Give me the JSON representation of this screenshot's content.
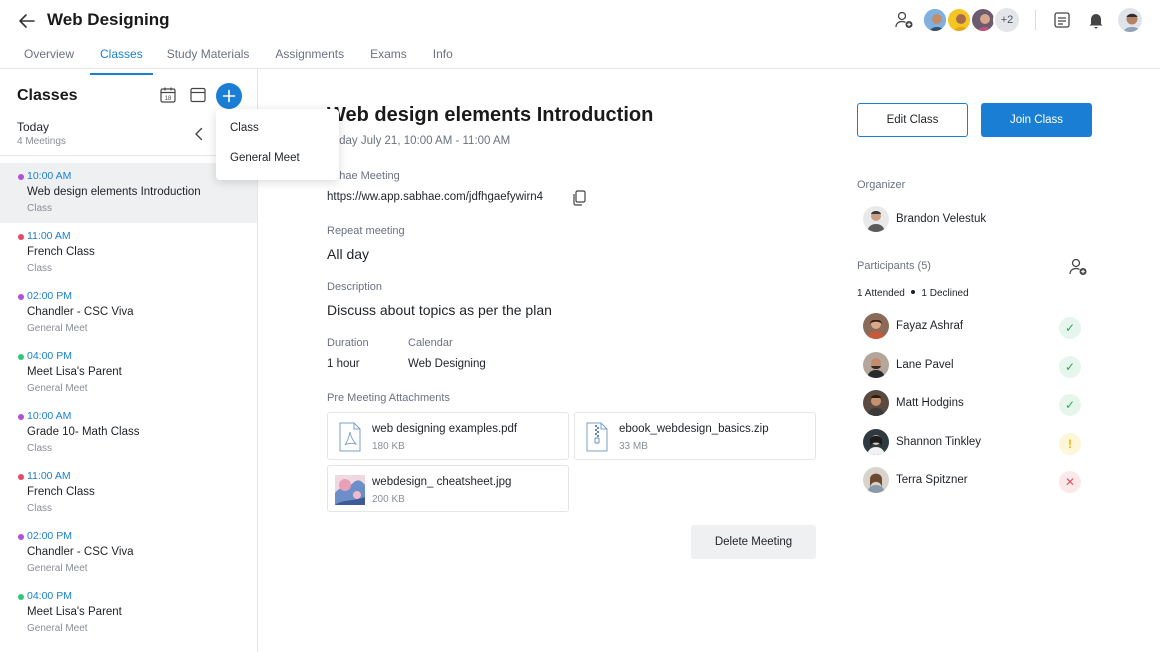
{
  "header": {
    "title": "Web Designing",
    "avatars_more": "+2",
    "tabs": [
      {
        "label": "Overview"
      },
      {
        "label": "Classes"
      },
      {
        "label": "Study Materials"
      },
      {
        "label": "Assignments"
      },
      {
        "label": "Exams"
      },
      {
        "label": "Info"
      }
    ],
    "active_tab": "Classes",
    "icons": [
      "back-arrow-icon",
      "add-user-icon",
      "layout-icon",
      "bell-icon"
    ]
  },
  "sidebar": {
    "title": "Classes",
    "date_icon_text": "18",
    "today": "Today",
    "meeting_count": "4 Meetings",
    "items": [
      {
        "time": "10:00 AM",
        "name": "Web design elements Introduction",
        "type": "Class",
        "dot": "#b14fd6"
      },
      {
        "time": "11:00 AM",
        "name": "French Class",
        "type": "Class",
        "dot": "#e8476a"
      },
      {
        "time": "02:00 PM",
        "name": "Chandler - CSC Viva",
        "type": "General Meet",
        "dot": "#b14fd6"
      },
      {
        "time": "04:00 PM",
        "name": "Meet Lisa's Parent",
        "type": "General Meet",
        "dot": "#34c77b"
      },
      {
        "time": "10:00 AM",
        "name": "Grade 10- Math Class",
        "type": "Class",
        "dot": "#b14fd6"
      },
      {
        "time": "11:00 AM",
        "name": "French Class",
        "type": "Class",
        "dot": "#e8476a"
      },
      {
        "time": "02:00 PM",
        "name": "Chandler - CSC Viva",
        "type": "General Meet",
        "dot": "#b14fd6"
      },
      {
        "time": "04:00 PM",
        "name": "Meet Lisa's Parent",
        "type": "General Meet",
        "dot": "#34c77b"
      }
    ]
  },
  "dropdown": {
    "items": [
      "Class",
      "General Meet"
    ]
  },
  "main": {
    "title": "Web design elements Introduction",
    "date": "esday July 21, 10:00 AM - 11:00 AM",
    "meeting_label": "abhae Meeting",
    "meeting_link": "https://ww.app.sabhae.com/jdfhgaefywirn4",
    "repeat_label": "Repeat meeting",
    "repeat_value": "All day",
    "description_label": "Description",
    "description_value": "Discuss about topics as per the plan",
    "duration_label": "Duration",
    "duration_value": "1 hour",
    "calendar_label": "Calendar",
    "calendar_value": "Web Designing",
    "attachments_label": "Pre Meeting Attachments",
    "attachments": [
      {
        "name": "web designing examples.pdf",
        "size": "180 KB",
        "icon": "pdf-file-icon"
      },
      {
        "name": "ebook_webdesign_basics.zip",
        "size": "33 MB",
        "icon": "zip-file-icon"
      },
      {
        "name": "webdesign_ cheatsheet.jpg",
        "size": "200 KB",
        "icon": "image-thumbnail"
      }
    ],
    "delete_label": "Delete Meeting"
  },
  "right": {
    "edit_label": "Edit Class",
    "join_label": "Join Class",
    "organizer_label": "Organizer",
    "organizer_name": "Brandon Velestuk",
    "participants_label": "Participants (5)",
    "attended": "1 Attended",
    "declined": "1 Declined",
    "participants": [
      {
        "name": "Fayaz Ashraf",
        "status": "accepted"
      },
      {
        "name": "Lane Pavel",
        "status": "accepted"
      },
      {
        "name": "Matt Hodgins",
        "status": "accepted"
      },
      {
        "name": "Shannon Tinkley",
        "status": "pending"
      },
      {
        "name": "Terra Spitzner",
        "status": "declined"
      }
    ],
    "colors": {
      "accent": "#1a7fd4",
      "accepted": "#2aa85a",
      "pending": "#e6b800",
      "declined": "#e0555f"
    }
  }
}
